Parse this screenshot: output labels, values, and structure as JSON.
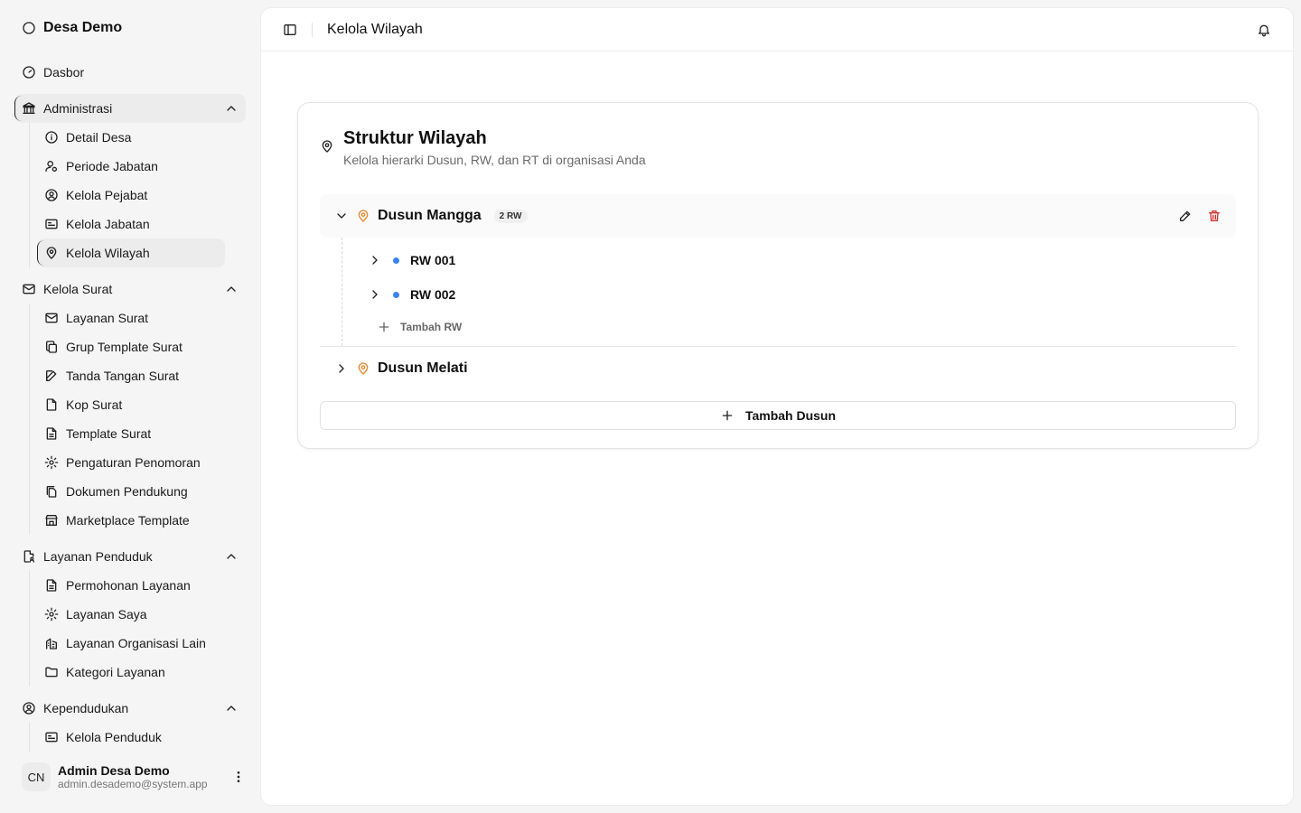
{
  "brand": {
    "name": "Desa Demo",
    "icon": "circle-logo-icon"
  },
  "sidebar": {
    "dashboard": "Dasbor",
    "groups": [
      {
        "label": "Administrasi",
        "items": [
          "Detail Desa",
          "Periode Jabatan",
          "Kelola Pejabat",
          "Kelola Jabatan",
          "Kelola Wilayah"
        ]
      },
      {
        "label": "Kelola Surat",
        "items": [
          "Layanan Surat",
          "Grup Template Surat",
          "Tanda Tangan Surat",
          "Kop Surat",
          "Template Surat",
          "Pengaturan Penomoran",
          "Dokumen Pendukung",
          "Marketplace Template"
        ]
      },
      {
        "label": "Layanan Penduduk",
        "items": [
          "Permohonan Layanan",
          "Layanan Saya",
          "Layanan Organisasi Lain",
          "Kategori Layanan"
        ]
      },
      {
        "label": "Kependudukan",
        "items": [
          "Kelola Penduduk"
        ]
      }
    ]
  },
  "user": {
    "initials": "CN",
    "name": "Admin Desa Demo",
    "email": "admin.desademo@system.app"
  },
  "header": {
    "title": "Kelola Wilayah"
  },
  "card": {
    "title": "Struktur Wilayah",
    "subtitle": "Kelola hierarki Dusun, RW, dan RT di organisasi Anda",
    "dusun": [
      {
        "name": "Dusun Mangga",
        "badge": "2 RW",
        "rw": [
          "RW 001",
          "RW 002"
        ],
        "add_rw": "Tambah RW"
      },
      {
        "name": "Dusun Melati"
      }
    ],
    "add_dusun": "Tambah Dusun"
  },
  "colors": {
    "accent_orange": "#e8872c",
    "rw_dot": "#3b82f6",
    "danger": "#d0312d"
  }
}
